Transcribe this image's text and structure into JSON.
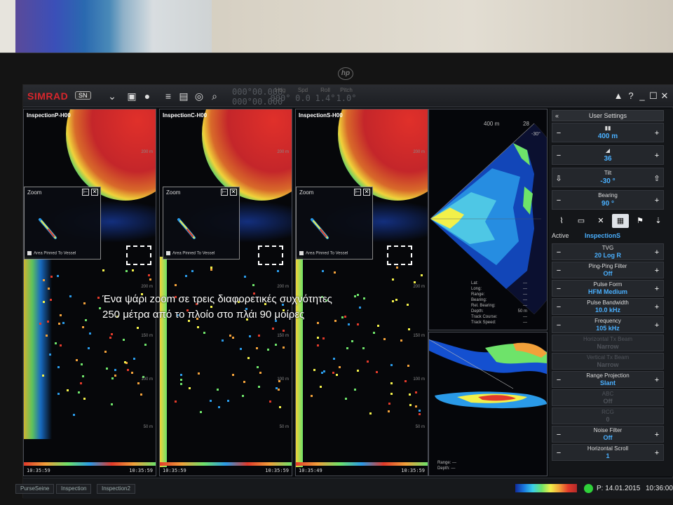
{
  "toolbar": {
    "brand": "SIMRAD",
    "brand_badge": "SN",
    "readouts": [
      {
        "label": "Hdg",
        "value": "000°"
      },
      {
        "label": "Spd",
        "value": "0.0"
      },
      {
        "label": "Roll",
        "value": "1.4°"
      },
      {
        "label": "Pitch",
        "value": "1.0°"
      }
    ],
    "coords_placeholder": "000°00.000",
    "window_buttons": [
      "▲",
      "?",
      "_",
      "☐",
      "✕"
    ]
  },
  "panels": [
    {
      "title": "InspectionP-H00",
      "time_start": "10:35:59",
      "time_end": "10:35:59"
    },
    {
      "title": "InspectionC-H00",
      "time_start": "10:35:59",
      "time_end": "10:35:59"
    },
    {
      "title": "InspectionS-H00",
      "time_start": "10:35:49",
      "time_end": "10:35:59"
    }
  ],
  "zoom": {
    "title": "Zoom",
    "pin_label": "Area Pinned To Vessel"
  },
  "sonar": {
    "range_label": "400 m",
    "gain_label": "28",
    "bearing_label": "-30°",
    "info": [
      {
        "k": "Lat:",
        "v": "—"
      },
      {
        "k": "Long:",
        "v": "—"
      },
      {
        "k": "Range:",
        "v": "—"
      },
      {
        "k": "Bearing:",
        "v": "—"
      },
      {
        "k": "Rel. Bearing:",
        "v": "—"
      },
      {
        "k": "Depth:",
        "v": "50 m"
      },
      {
        "k": "Track Course:",
        "v": "—"
      },
      {
        "k": "Track Speed:",
        "v": "—"
      }
    ]
  },
  "profile": {
    "info": [
      {
        "k": "Range:",
        "v": "—"
      },
      {
        "k": "Depth:",
        "v": "—"
      }
    ]
  },
  "settings": {
    "header": "User Settings",
    "range": {
      "value": "400 m"
    },
    "gain": {
      "value": "36"
    },
    "tilt": {
      "label": "Tilt",
      "value": "-30 °"
    },
    "bearing": {
      "label": "Bearing",
      "value": "90 °"
    },
    "active_label": "Active",
    "active_value": "InspectionS",
    "rows": [
      {
        "label": "TVG",
        "value": "20 Log R",
        "dim": false
      },
      {
        "label": "Ping-Ping Filter",
        "value": "Off",
        "dim": false
      },
      {
        "label": "Pulse Form",
        "value": "HFM Medium",
        "dim": false
      },
      {
        "label": "Pulse Bandwidth",
        "value": "10.0 kHz",
        "dim": false
      },
      {
        "label": "Frequency",
        "value": "105 kHz",
        "dim": false
      },
      {
        "label": "Horizontal Tx Beam",
        "value": "Narrow",
        "dim": true
      },
      {
        "label": "Vertical Tx Beam",
        "value": "Narrow",
        "dim": true
      },
      {
        "label": "Range Projection",
        "value": "Slant",
        "dim": false
      },
      {
        "label": "ABC",
        "value": "Off",
        "dim": true
      },
      {
        "label": "RCG",
        "value": "0",
        "dim": true
      },
      {
        "label": "Noise Filter",
        "value": "Off",
        "dim": false
      },
      {
        "label": "Horizontal Scroll",
        "value": "1",
        "dim": false
      }
    ]
  },
  "status": {
    "date": "P: 14.01.2015",
    "time": "10:36:00"
  },
  "bottom_tabs": [
    "PurseSeine",
    "Inspection",
    "Inspection2"
  ],
  "hp_logo": "hp",
  "caption": {
    "line1": "Ένα ψάρι zoom σε τρεις διαφορετικές συχνότητες",
    "line2": "250 μέτρα από το πλοίο στο πλάι 90 μοίρες"
  },
  "colors": {
    "accent": "#4ab0ff",
    "brand": "#d8262c",
    "status_ok": "#2fd13a"
  }
}
